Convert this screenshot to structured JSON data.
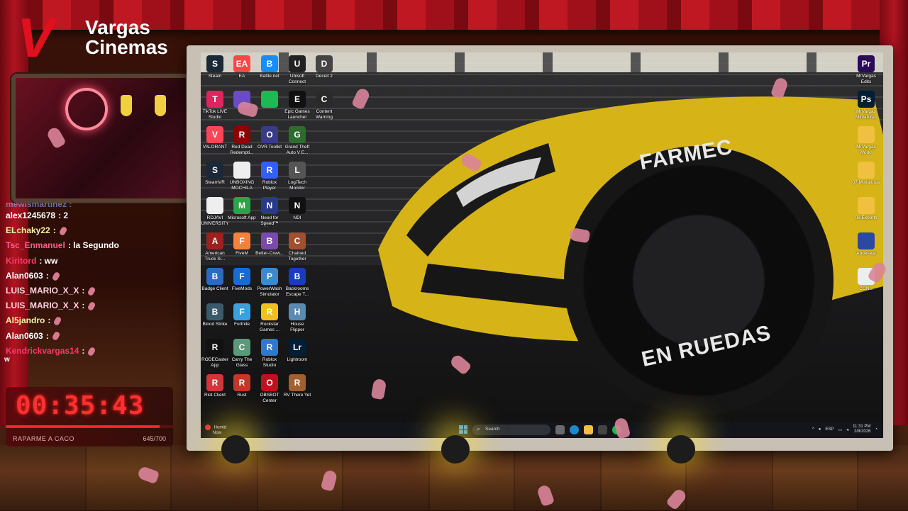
{
  "brand": {
    "logo_letter": "V",
    "line1": "Vargas",
    "line2": "Cinemas"
  },
  "chat": {
    "partial_top": "mewismartinez :",
    "messages": [
      {
        "user": "alex1245678",
        "text": ": 2",
        "color": "#ffffff"
      },
      {
        "user": "ELchaky22",
        "text": ":",
        "color": "#f5f5a0"
      },
      {
        "user": "Tsc_Enmanuel",
        "text": ": la Segundo",
        "color": "#ff5a8a"
      },
      {
        "user": "Kiritord",
        "text": ": ww",
        "color": "#ff3a6a"
      },
      {
        "user": "Alan0603",
        "text": ":",
        "color": "#ffffff"
      },
      {
        "user": "LUIS_MARIO_X_X",
        "text": ":",
        "color": "#ffd0e0"
      },
      {
        "user": "LUIS_MARIO_X_X",
        "text": ":",
        "color": "#ffd0e0"
      },
      {
        "user": "Al5jandro",
        "text": ":",
        "color": "#f5f5a0"
      },
      {
        "user": "Alan0603",
        "text": ":",
        "color": "#ffffff"
      },
      {
        "user": "Kendrickvargas14",
        "text": ":",
        "color": "#ff3a6a"
      }
    ],
    "stray": "w"
  },
  "timer": {
    "value": "00:35:43",
    "label": "RAPARME A CACO",
    "count": "645/700",
    "progress": 0.92
  },
  "desktop": {
    "icons_left": [
      {
        "label": "Steam",
        "glyph": "S",
        "color": "#1b2838"
      },
      {
        "label": "EA",
        "glyph": "EA",
        "color": "#ff4747"
      },
      {
        "label": "Battle.net",
        "glyph": "B",
        "color": "#148eff"
      },
      {
        "label": "Ubisoft Connect",
        "glyph": "U",
        "color": "#222222"
      },
      {
        "label": "Deceit 2",
        "glyph": "D",
        "color": "#444444"
      },
      {
        "label": "TikTok LIVE Studio",
        "glyph": "T",
        "color": "#e0245e"
      },
      {
        "label": "",
        "glyph": "",
        "color": "#6a4cc7"
      },
      {
        "label": "",
        "glyph": "",
        "color": "#1db954"
      },
      {
        "label": "Epic Games Launcher",
        "glyph": "E",
        "color": "#111111"
      },
      {
        "label": "Content Warning",
        "glyph": "C",
        "color": "#2a2a2a"
      },
      {
        "label": "VALORANT",
        "glyph": "V",
        "color": "#ff4655"
      },
      {
        "label": "Red Dead Redempti...",
        "glyph": "R",
        "color": "#8b0000"
      },
      {
        "label": "OVR Toolkit",
        "glyph": "O",
        "color": "#3a3a8a"
      },
      {
        "label": "Grand Theft Auto V E...",
        "glyph": "G",
        "color": "#2f6b2f"
      },
      {
        "label": "SteamVR",
        "glyph": "S",
        "color": "#1b2838"
      },
      {
        "label": "UNBOXING MOCHILA",
        "glyph": "",
        "color": "#eeeeee"
      },
      {
        "label": "Roblox Player",
        "glyph": "R",
        "color": "#335fff"
      },
      {
        "label": "LogiTech Monitor",
        "glyph": "L",
        "color": "#555555"
      },
      {
        "label": "RDJAVI UNIVERSITY",
        "glyph": "",
        "color": "#eeeeee"
      },
      {
        "label": "Microsoft App",
        "glyph": "M",
        "color": "#2aa34a"
      },
      {
        "label": "Need for Speed™ Heat",
        "glyph": "N",
        "color": "#2a3a8a"
      },
      {
        "label": "NDI",
        "glyph": "N",
        "color": "#111111"
      },
      {
        "label": "American Truck Si...",
        "glyph": "A",
        "color": "#a02020"
      },
      {
        "label": "FiveM",
        "glyph": "F",
        "color": "#f4823c"
      },
      {
        "label": "Better-Crew...",
        "glyph": "B",
        "color": "#7a4ab0"
      },
      {
        "label": "Chained Together",
        "glyph": "C",
        "color": "#a05030"
      },
      {
        "label": "Badge Client",
        "glyph": "B",
        "color": "#2a6ac0"
      },
      {
        "label": "FiveMods",
        "glyph": "F",
        "color": "#1a6ad0"
      },
      {
        "label": "PowerWash Simulator",
        "glyph": "P",
        "color": "#3a8ad0"
      },
      {
        "label": "Backrooms Escape T...",
        "glyph": "B",
        "color": "#1a3ac0"
      },
      {
        "label": "Blood Strike",
        "glyph": "B",
        "color": "#3a5a6a"
      },
      {
        "label": "Fortnite",
        "glyph": "F",
        "color": "#3aa0e0"
      },
      {
        "label": "Rockstar Games ...",
        "glyph": "R",
        "color": "#f0c020"
      },
      {
        "label": "House Flipper",
        "glyph": "H",
        "color": "#5a8ab0"
      },
      {
        "label": "RODECaster App",
        "glyph": "R",
        "color": "#111111"
      },
      {
        "label": "Carry The Glass",
        "glyph": "C",
        "color": "#5a9a7a"
      },
      {
        "label": "Roblox Studio",
        "glyph": "R",
        "color": "#2a7ad0"
      },
      {
        "label": "Lightroom",
        "glyph": "Lr",
        "color": "#001e36"
      },
      {
        "label": "Riot Client",
        "glyph": "R",
        "color": "#d13639"
      },
      {
        "label": "Rust",
        "glyph": "R",
        "color": "#c0392b"
      },
      {
        "label": "OBSBOT Center",
        "glyph": "O",
        "color": "#c01020"
      },
      {
        "label": "RV There Yet",
        "glyph": "R",
        "color": "#a06030"
      }
    ],
    "icons_right": [
      {
        "label": "MrVargas Edits",
        "glyph": "Pr",
        "color": "#2a0a5a"
      },
      {
        "label": "MrVargas Miniaturas",
        "glyph": "Ps",
        "color": "#001e36"
      },
      {
        "label": "MrVargas Works",
        "glyph": "",
        "color": "#f0c040"
      },
      {
        "label": "07 Miniaturas",
        "glyph": "",
        "color": "#f0c040"
      },
      {
        "label": "08 Exports",
        "glyph": "",
        "color": "#f0c040"
      },
      {
        "label": "Andeseat",
        "glyph": "",
        "color": "#2a4aa0"
      },
      {
        "label": "CON...",
        "glyph": "",
        "color": "#eeeeee"
      }
    ],
    "wallpaper_text": {
      "top": "FARMEC",
      "bottom": "EN RUEDAS"
    },
    "taskbar": {
      "weather_title": "Humid",
      "weather_sub": "Now",
      "search_placeholder": "Search",
      "language": "ESP",
      "time": "11:31 PM",
      "date": "2/8/2026"
    }
  },
  "colors": {
    "accent_red": "#e0101e",
    "timer_red": "#ff3030",
    "hand_pink": "#d9849a"
  }
}
